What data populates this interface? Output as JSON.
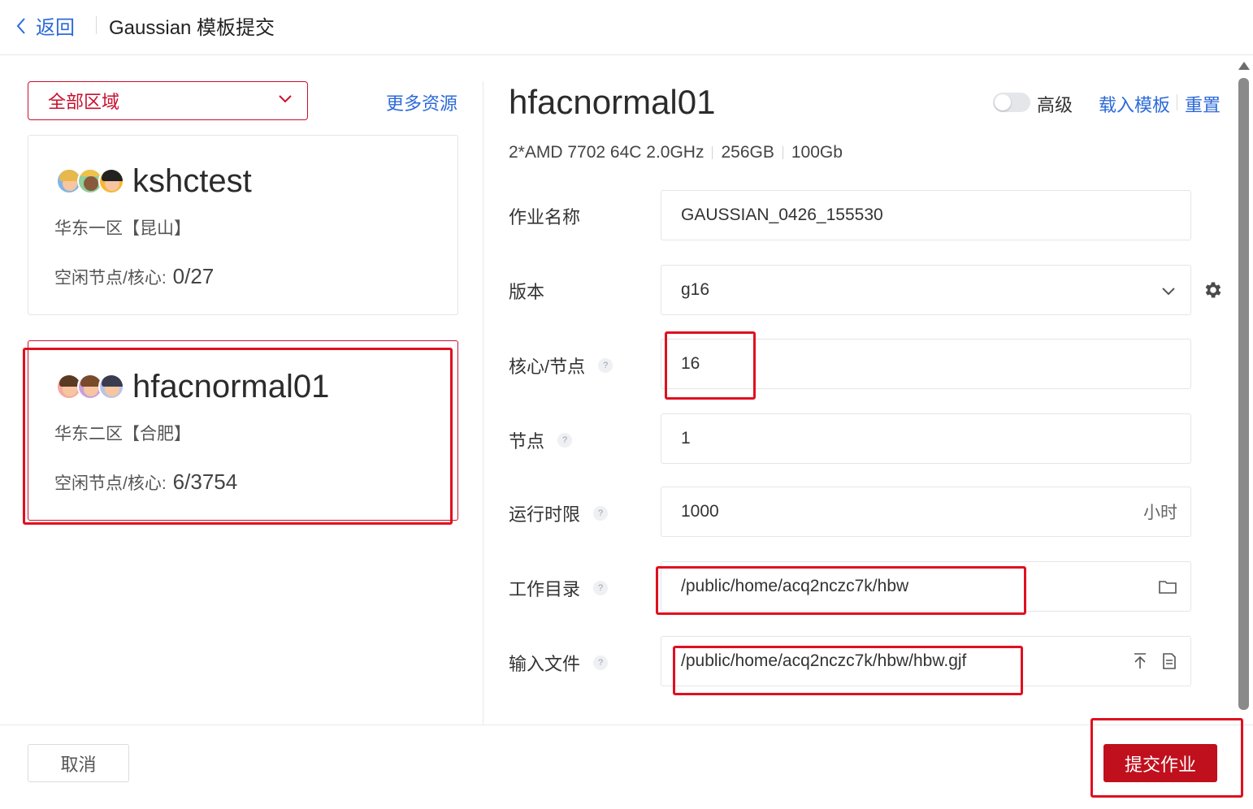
{
  "header": {
    "back_label": "返回",
    "title": "Gaussian 模板提交"
  },
  "left": {
    "region_select": {
      "value": "全部区域"
    },
    "more_resources": "更多资源",
    "clusters": [
      {
        "name": "kshctest",
        "region": "华东一区【昆山】",
        "free_label": "空闲节点/核心:",
        "free_value": "0/27",
        "selected": false
      },
      {
        "name": "hfacnormal01",
        "region": "华东二区【合肥】",
        "free_label": "空闲节点/核心:",
        "free_value": "6/3754",
        "selected": true
      }
    ]
  },
  "right": {
    "title": "hfacnormal01",
    "advanced_label": "高级",
    "advanced_on": false,
    "load_template": "载入模板",
    "reset": "重置",
    "specs": {
      "cpu": "2*AMD 7702 64C 2.0GHz",
      "memory": "256GB",
      "disk": "100Gb"
    },
    "form": {
      "job_name": {
        "label": "作业名称",
        "value": "GAUSSIAN_0426_155530"
      },
      "version": {
        "label": "版本",
        "value": "g16"
      },
      "cores_per_node": {
        "label": "核心/节点",
        "value": "16"
      },
      "nodes": {
        "label": "节点",
        "value": "1"
      },
      "runtime_limit": {
        "label": "运行时限",
        "value": "1000",
        "unit": "小时"
      },
      "work_dir": {
        "label": "工作目录",
        "value": "/public/home/acq2nczc7k/hbw"
      },
      "input_file": {
        "label": "输入文件",
        "value": "/public/home/acq2nczc7k/hbw/hbw.gjf"
      }
    }
  },
  "footer": {
    "cancel": "取消",
    "submit": "提交作业"
  },
  "colors": {
    "brand_red": "#c0101d",
    "link_blue": "#2d6ad9",
    "highlight_red": "#e0101f"
  },
  "help_glyph": "?"
}
